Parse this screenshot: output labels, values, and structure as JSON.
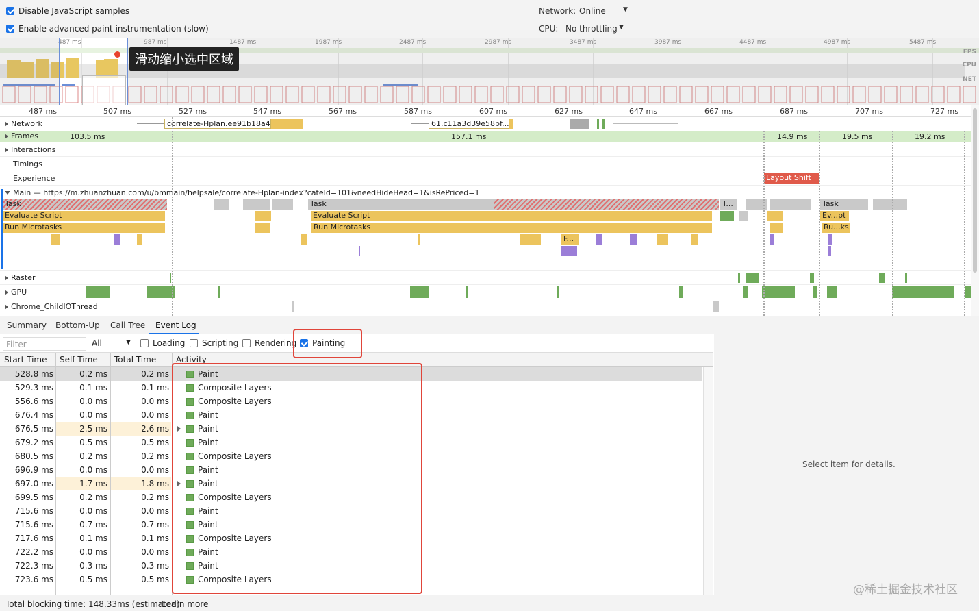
{
  "settings": {
    "disable_js_samples": "Disable JavaScript samples",
    "advanced_paint": "Enable advanced paint instrumentation (slow)",
    "network_label": "Network:",
    "network_value": "Online",
    "cpu_label": "CPU:",
    "cpu_value": "No throttling"
  },
  "overview": {
    "ticks": [
      "487 ms",
      "987 ms",
      "1487 ms",
      "1987 ms",
      "2487 ms",
      "2987 ms",
      "3487 ms",
      "3987 ms",
      "4487 ms",
      "4987 ms",
      "5487 ms"
    ],
    "lanes": {
      "fps": "FPS",
      "cpu": "CPU",
      "net": "NET"
    },
    "tooltip": "滑动缩小选中区域"
  },
  "ruler": {
    "ticks": [
      "487 ms",
      "507 ms",
      "527 ms",
      "547 ms",
      "567 ms",
      "587 ms",
      "607 ms",
      "627 ms",
      "647 ms",
      "667 ms",
      "687 ms",
      "707 ms",
      "727 ms"
    ]
  },
  "tracks": {
    "network": "Network",
    "network_req1": "correlate-Hplan.ee91b18a4",
    "network_req2": "61.c11a3d39e58bf...",
    "frames": "Frames",
    "frame_times": [
      "103.5 ms",
      "157.1 ms",
      "14.9 ms",
      "19.5 ms",
      "19.2 ms"
    ],
    "interactions": "Interactions",
    "timings": "Timings",
    "experience": "Experience",
    "layout_shift": "Layout Shift",
    "main": "Main — https://m.zhuanzhuan.com/u/bmmain/helpsale/correlate-Hplan-index?cateId=101&needHideHead=1&isRePriced=1",
    "task": "Task",
    "task_short": "T...",
    "evaluate_script": "Evaluate Script",
    "run_microtasks": "Run Microtasks",
    "ev_short": "Ev...pt",
    "ru_short": "Ru...ks",
    "f_short": "F...",
    "raster": "Raster",
    "gpu": "GPU",
    "chrome_io": "Chrome_ChildIOThread"
  },
  "tabs": [
    "Summary",
    "Bottom-Up",
    "Call Tree",
    "Event Log"
  ],
  "active_tab": "Event Log",
  "filters": {
    "placeholder": "Filter",
    "all": "All",
    "loading": "Loading",
    "scripting": "Scripting",
    "rendering": "Rendering",
    "painting": "Painting"
  },
  "table": {
    "headers": [
      "Start Time",
      "Self Time",
      "Total Time",
      "Activity"
    ],
    "rows": [
      {
        "start": "528.8 ms",
        "self": "0.2 ms",
        "total": "0.2 ms",
        "activity": "Paint"
      },
      {
        "start": "529.3 ms",
        "self": "0.1 ms",
        "total": "0.1 ms",
        "activity": "Composite Layers"
      },
      {
        "start": "556.6 ms",
        "self": "0.0 ms",
        "total": "0.0 ms",
        "activity": "Composite Layers"
      },
      {
        "start": "676.4 ms",
        "self": "0.0 ms",
        "total": "0.0 ms",
        "activity": "Paint"
      },
      {
        "start": "676.5 ms",
        "self": "2.5 ms",
        "total": "2.6 ms",
        "activity": "Paint"
      },
      {
        "start": "679.2 ms",
        "self": "0.5 ms",
        "total": "0.5 ms",
        "activity": "Paint"
      },
      {
        "start": "680.5 ms",
        "self": "0.2 ms",
        "total": "0.2 ms",
        "activity": "Composite Layers"
      },
      {
        "start": "696.9 ms",
        "self": "0.0 ms",
        "total": "0.0 ms",
        "activity": "Paint"
      },
      {
        "start": "697.0 ms",
        "self": "1.7 ms",
        "total": "1.8 ms",
        "activity": "Paint"
      },
      {
        "start": "699.5 ms",
        "self": "0.2 ms",
        "total": "0.2 ms",
        "activity": "Composite Layers"
      },
      {
        "start": "715.6 ms",
        "self": "0.0 ms",
        "total": "0.0 ms",
        "activity": "Paint"
      },
      {
        "start": "715.6 ms",
        "self": "0.7 ms",
        "total": "0.7 ms",
        "activity": "Paint"
      },
      {
        "start": "717.6 ms",
        "self": "0.1 ms",
        "total": "0.1 ms",
        "activity": "Composite Layers"
      },
      {
        "start": "722.2 ms",
        "self": "0.0 ms",
        "total": "0.0 ms",
        "activity": "Paint"
      },
      {
        "start": "722.3 ms",
        "self": "0.3 ms",
        "total": "0.3 ms",
        "activity": "Paint"
      },
      {
        "start": "723.6 ms",
        "self": "0.5 ms",
        "total": "0.5 ms",
        "activity": "Composite Layers"
      }
    ]
  },
  "details": "Select item for details.",
  "footer": {
    "text": "Total blocking time: 148.33ms (estimated)",
    "link": "Learn more"
  },
  "watermark": "@稀土掘金技术社区",
  "colors": {
    "script": "#ecc45d",
    "task": "#c9c9c9",
    "paint": "#6fab5a",
    "layout_shift": "#e05a4a",
    "frames": "#d4ecc8",
    "highlight": "#e0453a",
    "accent": "#1a73e8"
  }
}
